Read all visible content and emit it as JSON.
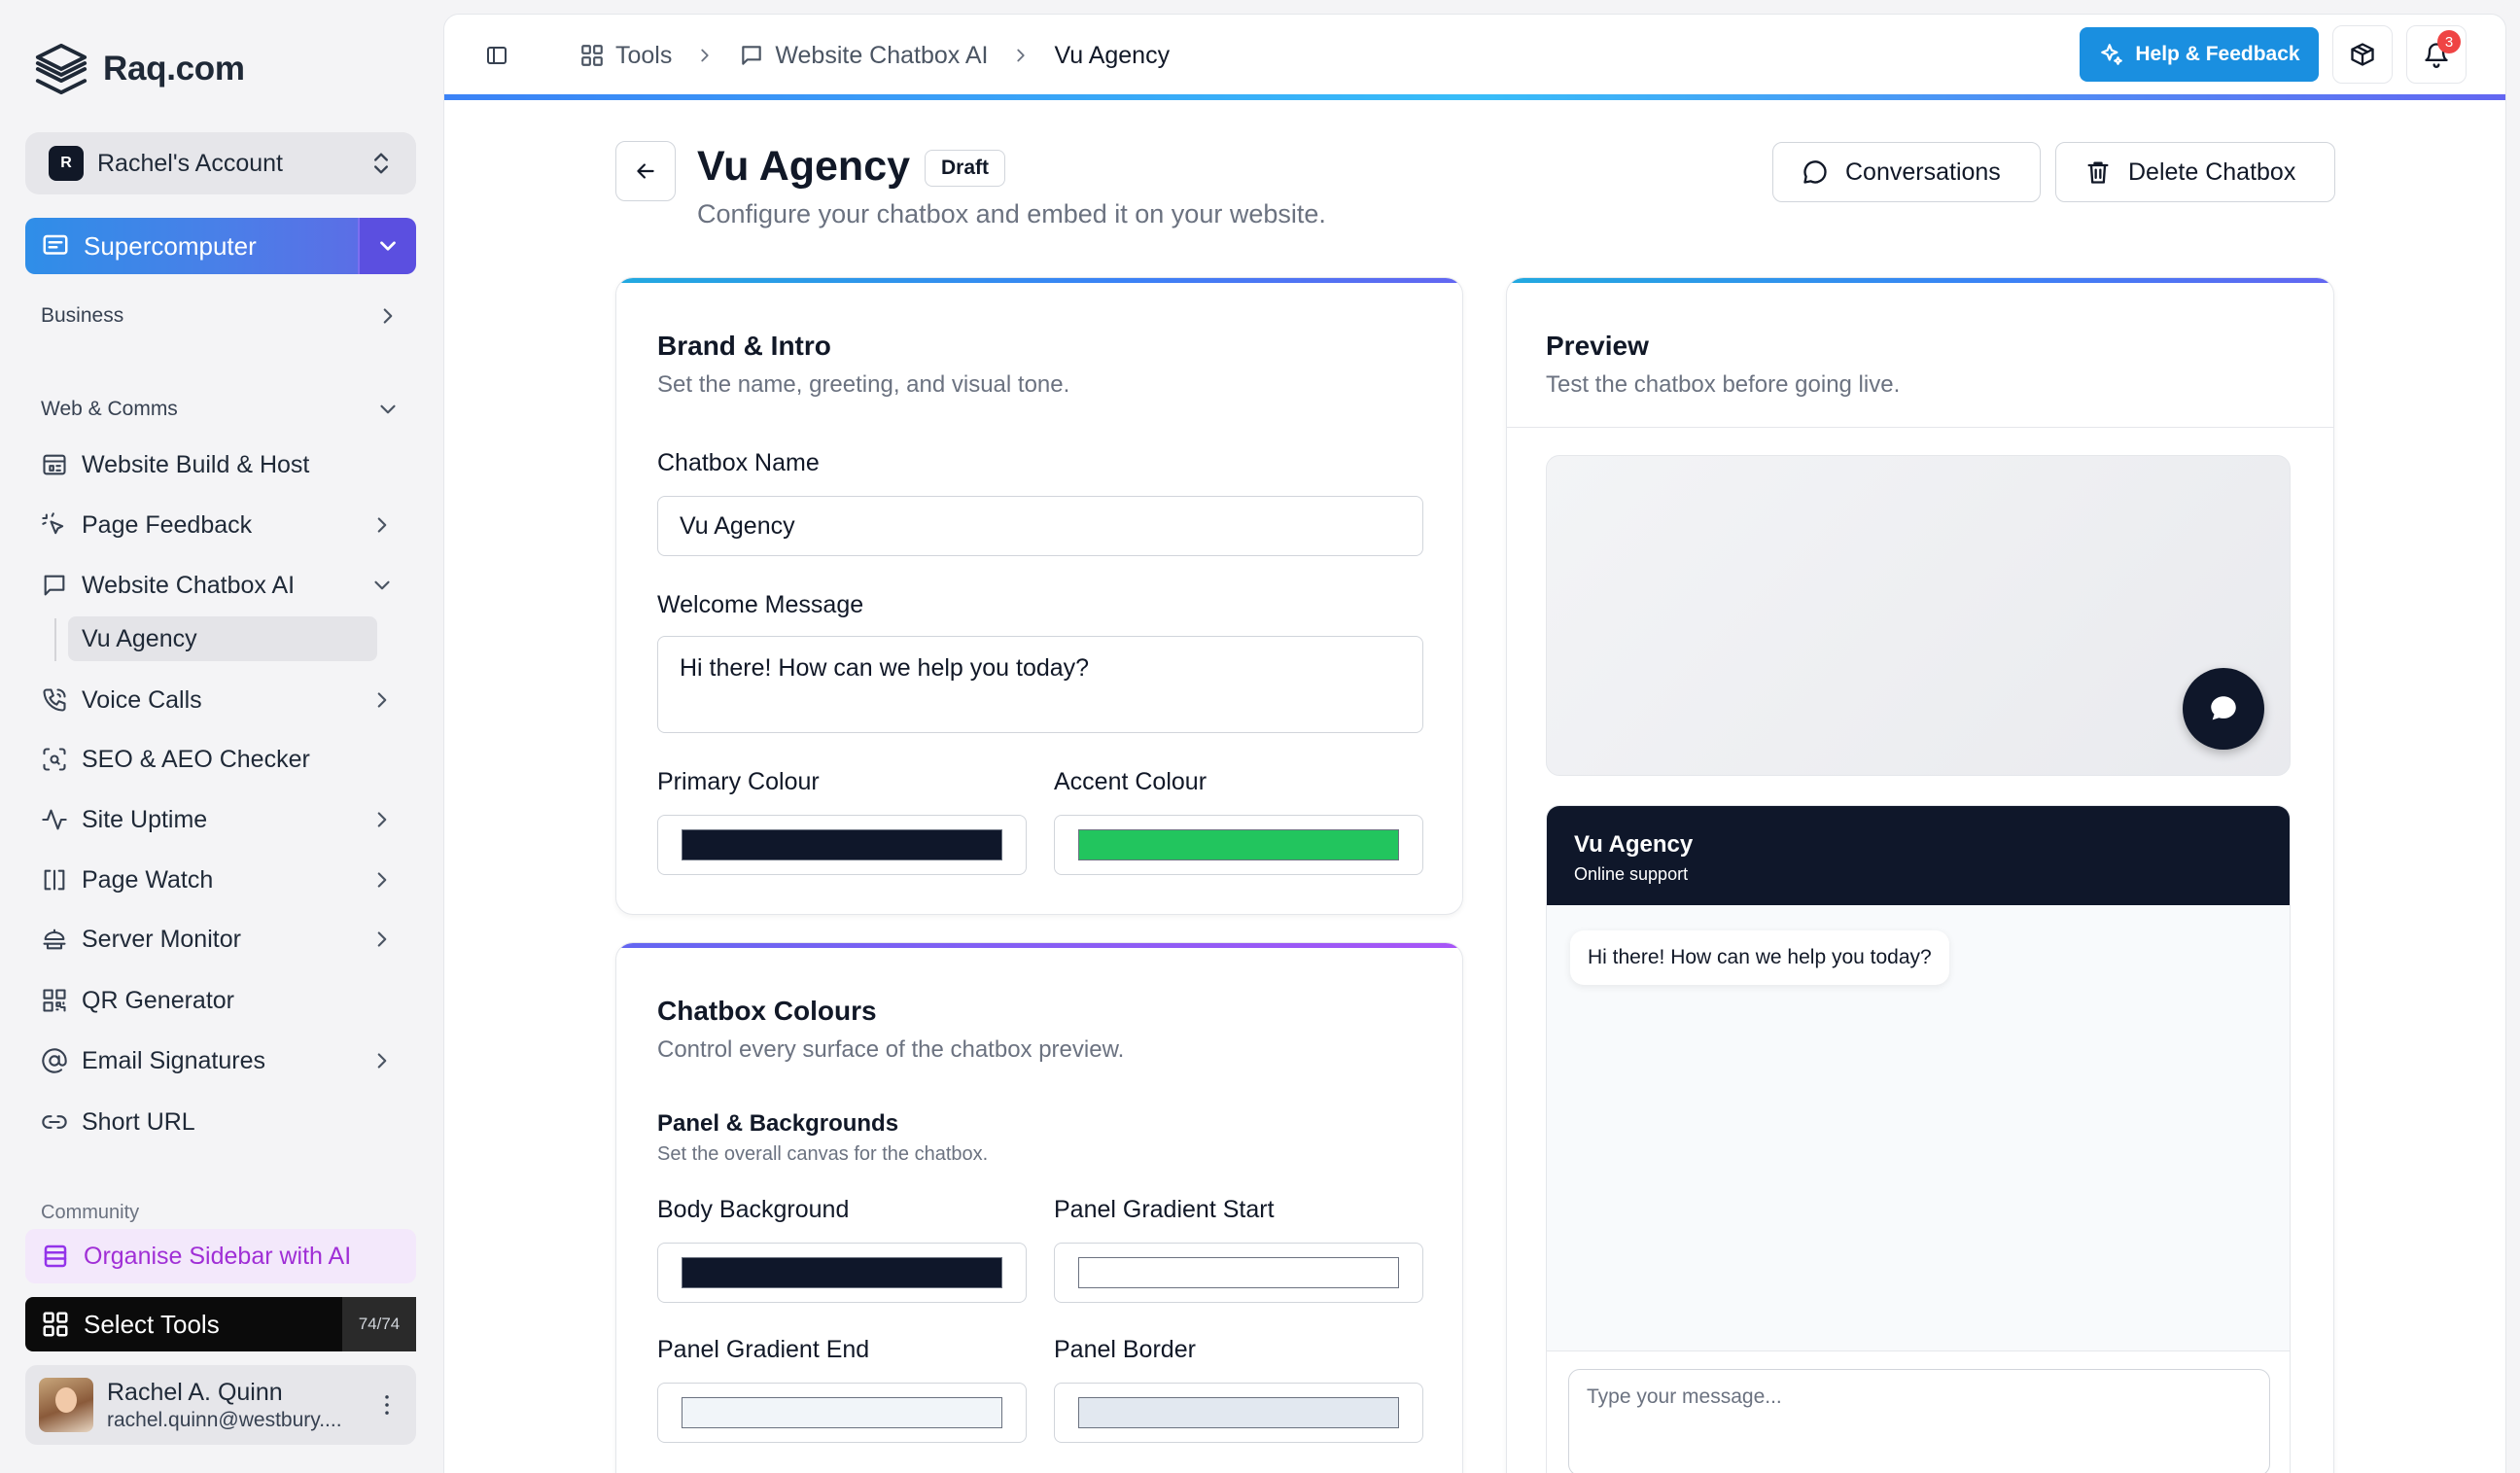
{
  "sidebar": {
    "logo": "Raq.com",
    "account": {
      "badge": "R",
      "label": "Rachel's Account"
    },
    "supercomputer": "Supercomputer",
    "sections": {
      "business": "Business",
      "web_comms": "Web & Comms",
      "community": "Community"
    },
    "items": [
      {
        "label": "Website Build & Host",
        "icon": "layout-icon"
      },
      {
        "label": "Page Feedback",
        "icon": "sparkle-click-icon"
      },
      {
        "label": "Website Chatbox AI",
        "icon": "message-square-icon"
      },
      {
        "label": "Voice Calls",
        "icon": "phone-icon"
      },
      {
        "label": "SEO & AEO Checker",
        "icon": "scan-search-icon"
      },
      {
        "label": "Site Uptime",
        "icon": "activity-icon"
      },
      {
        "label": "Page Watch",
        "icon": "columns-icon"
      },
      {
        "label": "Server Monitor",
        "icon": "server-icon"
      },
      {
        "label": "QR Generator",
        "icon": "qr-code-icon"
      },
      {
        "label": "Email Signatures",
        "icon": "at-sign-icon"
      },
      {
        "label": "Short URL",
        "icon": "link-icon"
      }
    ],
    "sub_item": "Vu Agency",
    "organise": "Organise Sidebar with AI",
    "select_tools": {
      "label": "Select Tools",
      "count": "74/74"
    },
    "user": {
      "name": "Rachel A. Quinn",
      "email": "rachel.quinn@westbury...."
    }
  },
  "topbar": {
    "breadcrumbs": [
      "Tools",
      "Website Chatbox AI",
      "Vu Agency"
    ],
    "help": "Help & Feedback",
    "notification_count": "3"
  },
  "header": {
    "title": "Vu Agency",
    "status": "Draft",
    "subtitle": "Configure your chatbox and embed it on your website.",
    "conversations": "Conversations",
    "delete": "Delete Chatbox"
  },
  "brand": {
    "title": "Brand & Intro",
    "subtitle": "Set the name, greeting, and visual tone.",
    "name_label": "Chatbox Name",
    "name_value": "Vu Agency",
    "welcome_label": "Welcome Message",
    "welcome_value": "Hi there! How can we help you today?",
    "primary_label": "Primary Colour",
    "primary_color": "#0f172a",
    "accent_label": "Accent Colour",
    "accent_color": "#22c55e"
  },
  "colours": {
    "title": "Chatbox Colours",
    "subtitle": "Control every surface of the chatbox preview.",
    "group_title": "Panel & Backgrounds",
    "group_subtitle": "Set the overall canvas for the chatbox.",
    "body_bg_label": "Body Background",
    "body_bg_color": "#0f172a",
    "grad_start_label": "Panel Gradient Start",
    "grad_start_color": "#ffffff",
    "grad_end_label": "Panel Gradient End",
    "grad_end_color": "#f1f5f9",
    "border_label": "Panel Border",
    "border_color": "#e2e8f0"
  },
  "preview": {
    "title": "Preview",
    "subtitle": "Test the chatbox before going live.",
    "chat_name": "Vu Agency",
    "chat_status": "Online support",
    "greeting": "Hi there! How can we help you today?",
    "input_placeholder": "Type your message..."
  }
}
